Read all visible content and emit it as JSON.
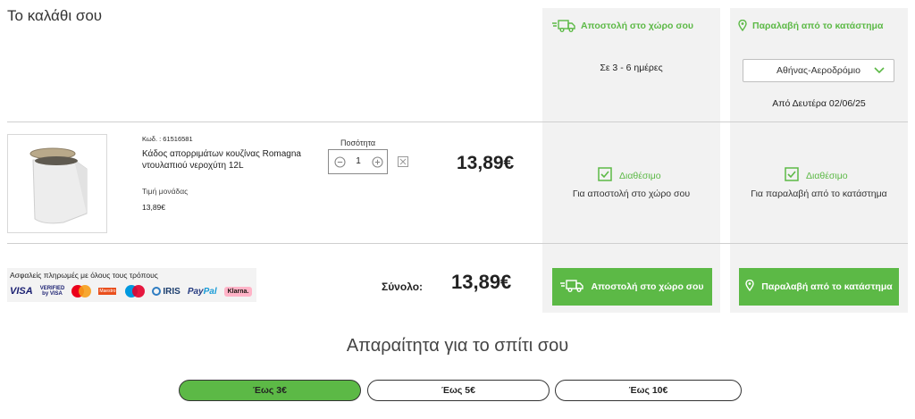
{
  "page": {
    "title": "Το καλάθι σου"
  },
  "delivery": {
    "home_label": "Αποστολή στο χώρο σου",
    "store_label": "Παραλαβή από το κατάστημα",
    "home_eta": "Σε 3 - 6 ημέρες",
    "store_selected": "Αθήνας-Αεροδρόμιο",
    "store_from": "Από Δευτέρα 02/06/25"
  },
  "item": {
    "code": "Κωδ. : 61516581",
    "name": "Κάδος απορριμάτων κουζίνας Romagna ντουλαπιού νεροχύτη 12L",
    "unit_price_label": "Τιμή μονάδας",
    "unit_price": "13,89€",
    "quantity_label": "Ποσότητα",
    "quantity": "1",
    "price": "13,89€",
    "home_status": "Διαθέσιμο",
    "home_status_sub": "Για αποστολή στο χώρο σου",
    "store_status": "Διαθέσιμο",
    "store_status_sub": "Για παραλαβή από το κατάστημα"
  },
  "payment": {
    "title": "Ασφαλείς πληρωμές με όλους τους τρόπους",
    "logos": {
      "visa": "VISA",
      "vbv_1": "VERIFIED",
      "vbv_2": "by VISA",
      "maestro_small": "Maestro",
      "iris": "IRIS",
      "paypal_a": "Pay",
      "paypal_b": "Pal",
      "klarna": "Klarna."
    }
  },
  "summary": {
    "total_label": "Σύνολο:",
    "total_price": "13,89€",
    "cta_home": "Αποστολή στο χώρο σου",
    "cta_store": "Παραλαβή από το κατάστημα"
  },
  "essentials": {
    "title": "Απαραίτητα για το σπίτι σου",
    "filters": [
      "Έως 3€",
      "Έως 5€",
      "Έως 10€"
    ],
    "active_index": 0
  },
  "colors": {
    "accent": "#5cb946",
    "panel": "#f2f2f2"
  },
  "icons": [
    "truck-icon",
    "location-pin-icon",
    "chevron-down-icon",
    "minus-circle-icon",
    "plus-circle-icon",
    "remove-icon",
    "checkbox-check-icon"
  ]
}
